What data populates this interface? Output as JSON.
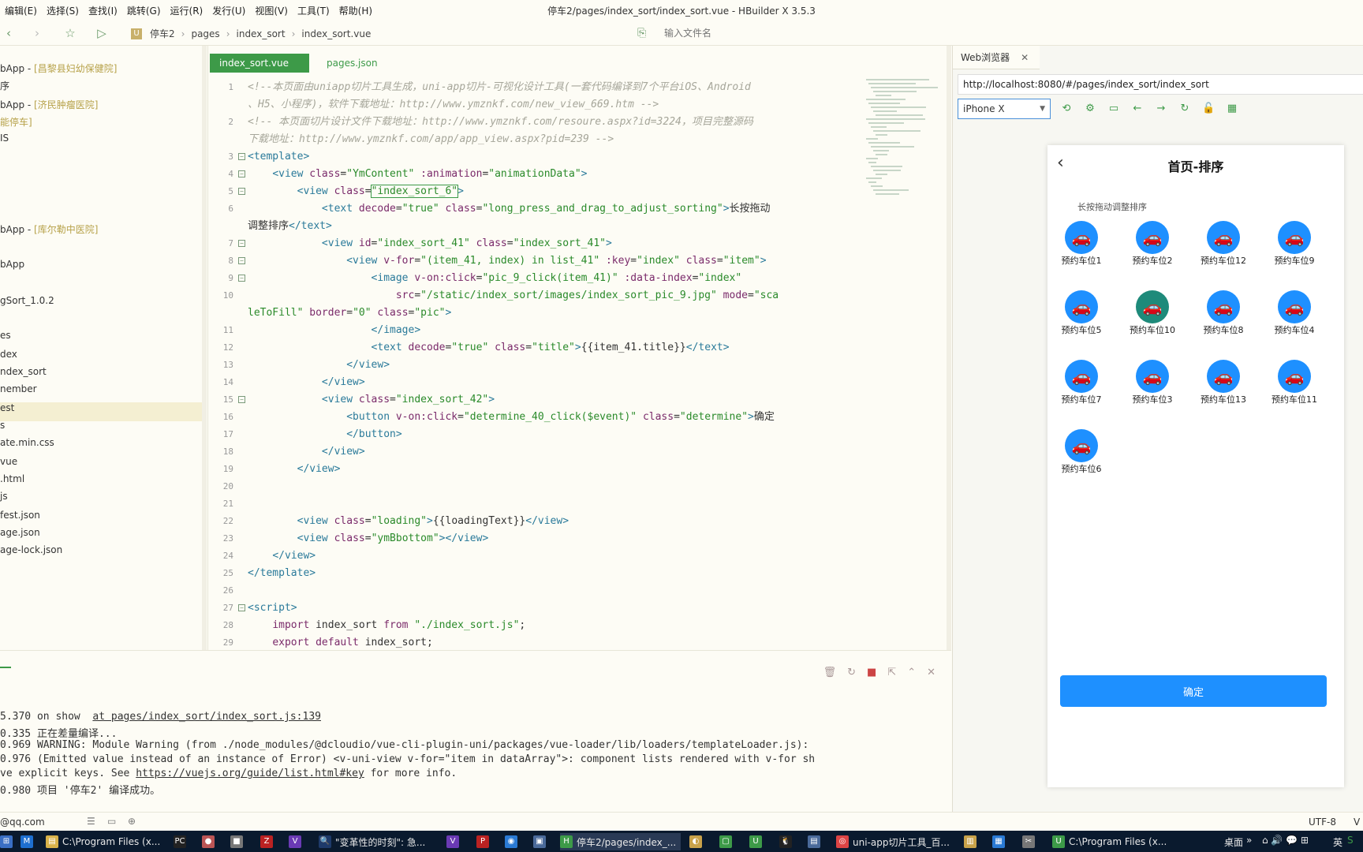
{
  "menu": [
    "编辑(E)",
    "选择(S)",
    "查找(I)",
    "跳转(G)",
    "运行(R)",
    "发行(U)",
    "视图(V)",
    "工具(T)",
    "帮助(H)"
  ],
  "window_title": "停车2/pages/index_sort/index_sort.vue - HBuilder X 3.5.3",
  "breadcrumb": [
    "停车2",
    "pages",
    "index_sort",
    "index_sort.vue"
  ],
  "file_search_placeholder": "输入文件名",
  "sidebar": {
    "items": [
      {
        "pre": "bApp - ",
        "hl": "[昌黎县妇幼保健院]"
      },
      {
        "pre": "序",
        "hl": ""
      },
      {
        "pre": "bApp - ",
        "hl": "[济民肿瘤医院]"
      },
      {
        "pre": "",
        "hl": "能停车]"
      },
      {
        "pre": "IS",
        "hl": ""
      },
      {
        "pre": "bApp - ",
        "hl": "[库尔勒中医院]"
      },
      {
        "pre": "bApp",
        "hl": ""
      },
      {
        "pre": "gSort_1.0.2",
        "hl": ""
      },
      {
        "pre": "es",
        "hl": ""
      },
      {
        "pre": "dex",
        "hl": ""
      },
      {
        "pre": "ndex_sort",
        "hl": ""
      },
      {
        "pre": "nember",
        "hl": ""
      },
      {
        "pre": "est",
        "hl": ""
      },
      {
        "pre": "s",
        "hl": ""
      },
      {
        "pre": "ate.min.css",
        "hl": ""
      },
      {
        "pre": "vue",
        "hl": ""
      },
      {
        "pre": ".html",
        "hl": ""
      },
      {
        "pre": "js",
        "hl": ""
      },
      {
        "pre": "fest.json",
        "hl": ""
      },
      {
        "pre": "age.json",
        "hl": ""
      },
      {
        "pre": "age-lock.json",
        "hl": ""
      }
    ]
  },
  "editor": {
    "tabs": [
      "index_sort.vue",
      "pages.json"
    ],
    "lines": [
      {
        "n": "1",
        "fold": false,
        "parts": [
          [
            "cm",
            "<!--本页面由uniapp切片工具生成，uni-app切片-可视化设计工具(一套代码编译到7个平台iOS、Android"
          ]
        ]
      },
      {
        "n": "",
        "fold": false,
        "parts": [
          [
            "cm",
            "、H5、小程序)，软件下载地址：http://www.ymznkf.com/new_view_669.htm -->"
          ]
        ]
      },
      {
        "n": "2",
        "fold": false,
        "parts": [
          [
            "cm",
            "<!-- 本页面切片设计文件下载地址：http://www.ymznkf.com/resoure.aspx?id=3224，项目完整源码"
          ]
        ]
      },
      {
        "n": "",
        "fold": false,
        "parts": [
          [
            "cm",
            "下载地址：http://www.ymznkf.com/app/app_view.aspx?pid=239 -->"
          ]
        ]
      },
      {
        "n": "3",
        "fold": true,
        "parts": [
          [
            "tg",
            "<template>"
          ]
        ]
      },
      {
        "n": "4",
        "fold": true,
        "parts": [
          [
            "tx",
            "    "
          ],
          [
            "tg",
            "<view "
          ],
          [
            "at",
            "class"
          ],
          [
            "tx",
            "="
          ],
          [
            "st",
            "\"YmContent\""
          ],
          [
            "at",
            " :animation"
          ],
          [
            "tx",
            "="
          ],
          [
            "st",
            "\"animationData\""
          ],
          [
            "tg",
            ">"
          ]
        ]
      },
      {
        "n": "5",
        "fold": true,
        "parts": [
          [
            "tx",
            "        "
          ],
          [
            "tg",
            "<view "
          ],
          [
            "at",
            "class"
          ],
          [
            "tx",
            "="
          ],
          [
            "st",
            "\"index_sort_6\""
          ],
          [
            "tg",
            ">"
          ]
        ]
      },
      {
        "n": "6",
        "fold": false,
        "parts": [
          [
            "tx",
            "            "
          ],
          [
            "tg",
            "<text "
          ],
          [
            "at",
            "decode"
          ],
          [
            "tx",
            "="
          ],
          [
            "st",
            "\"true\""
          ],
          [
            "at",
            " class"
          ],
          [
            "tx",
            "="
          ],
          [
            "st",
            "\"long_press_and_drag_to_adjust_sorting\""
          ],
          [
            "tg",
            ">"
          ],
          [
            "tx",
            "长按拖动"
          ]
        ]
      },
      {
        "n": "",
        "fold": false,
        "parts": [
          [
            "tx",
            "调整排序"
          ],
          [
            "tg",
            "</text>"
          ]
        ]
      },
      {
        "n": "7",
        "fold": true,
        "parts": [
          [
            "tx",
            "            "
          ],
          [
            "tg",
            "<view "
          ],
          [
            "at",
            "id"
          ],
          [
            "tx",
            "="
          ],
          [
            "st",
            "\"index_sort_41\""
          ],
          [
            "at",
            " class"
          ],
          [
            "tx",
            "="
          ],
          [
            "st",
            "\"index_sort_41\""
          ],
          [
            "tg",
            ">"
          ]
        ]
      },
      {
        "n": "8",
        "fold": true,
        "parts": [
          [
            "tx",
            "                "
          ],
          [
            "tg",
            "<view "
          ],
          [
            "at",
            "v-for"
          ],
          [
            "tx",
            "="
          ],
          [
            "st",
            "\"(item_41, index) in list_41\""
          ],
          [
            "at",
            " :key"
          ],
          [
            "tx",
            "="
          ],
          [
            "st",
            "\"index\""
          ],
          [
            "at",
            " class"
          ],
          [
            "tx",
            "="
          ],
          [
            "st",
            "\"item\""
          ],
          [
            "tg",
            ">"
          ]
        ]
      },
      {
        "n": "9",
        "fold": true,
        "parts": [
          [
            "tx",
            "                    "
          ],
          [
            "tg",
            "<image "
          ],
          [
            "at",
            "v-on:click"
          ],
          [
            "tx",
            "="
          ],
          [
            "st",
            "\"pic_9_click(item_41)\""
          ],
          [
            "at",
            " :data-index"
          ],
          [
            "tx",
            "="
          ],
          [
            "st",
            "\"index\""
          ]
        ]
      },
      {
        "n": "10",
        "fold": false,
        "parts": [
          [
            "tx",
            "                        "
          ],
          [
            "at",
            "src"
          ],
          [
            "tx",
            "="
          ],
          [
            "st",
            "\"/static/index_sort/images/index_sort_pic_9.jpg\""
          ],
          [
            "at",
            " mode"
          ],
          [
            "tx",
            "="
          ],
          [
            "st",
            "\"sca"
          ]
        ]
      },
      {
        "n": "",
        "fold": false,
        "parts": [
          [
            "st",
            "leToFill\""
          ],
          [
            "at",
            " border"
          ],
          [
            "tx",
            "="
          ],
          [
            "st",
            "\"0\""
          ],
          [
            "at",
            " class"
          ],
          [
            "tx",
            "="
          ],
          [
            "st",
            "\"pic\""
          ],
          [
            "tg",
            ">"
          ]
        ]
      },
      {
        "n": "11",
        "fold": false,
        "parts": [
          [
            "tx",
            "                    "
          ],
          [
            "tg",
            "</image>"
          ]
        ]
      },
      {
        "n": "12",
        "fold": false,
        "parts": [
          [
            "tx",
            "                    "
          ],
          [
            "tg",
            "<text "
          ],
          [
            "at",
            "decode"
          ],
          [
            "tx",
            "="
          ],
          [
            "st",
            "\"true\""
          ],
          [
            "at",
            " class"
          ],
          [
            "tx",
            "="
          ],
          [
            "st",
            "\"title\""
          ],
          [
            "tg",
            ">"
          ],
          [
            "tx",
            "{{item_41.title}}"
          ],
          [
            "tg",
            "</text>"
          ]
        ]
      },
      {
        "n": "13",
        "fold": false,
        "parts": [
          [
            "tx",
            "                "
          ],
          [
            "tg",
            "</view>"
          ]
        ]
      },
      {
        "n": "14",
        "fold": false,
        "parts": [
          [
            "tx",
            "            "
          ],
          [
            "tg",
            "</view>"
          ]
        ]
      },
      {
        "n": "15",
        "fold": true,
        "parts": [
          [
            "tx",
            "            "
          ],
          [
            "tg",
            "<view "
          ],
          [
            "at",
            "class"
          ],
          [
            "tx",
            "="
          ],
          [
            "st",
            "\"index_sort_42\""
          ],
          [
            "tg",
            ">"
          ]
        ]
      },
      {
        "n": "16",
        "fold": false,
        "parts": [
          [
            "tx",
            "                "
          ],
          [
            "tg",
            "<button "
          ],
          [
            "at",
            "v-on:click"
          ],
          [
            "tx",
            "="
          ],
          [
            "st",
            "\"determine_40_click($event)\""
          ],
          [
            "at",
            " class"
          ],
          [
            "tx",
            "="
          ],
          [
            "st",
            "\"determine\""
          ],
          [
            "tg",
            ">"
          ],
          [
            "tx",
            "确定"
          ]
        ]
      },
      {
        "n": "17",
        "fold": false,
        "parts": [
          [
            "tx",
            "                "
          ],
          [
            "tg",
            "</button>"
          ]
        ]
      },
      {
        "n": "18",
        "fold": false,
        "parts": [
          [
            "tx",
            "            "
          ],
          [
            "tg",
            "</view>"
          ]
        ]
      },
      {
        "n": "19",
        "fold": false,
        "parts": [
          [
            "tx",
            "        "
          ],
          [
            "tg",
            "</view>"
          ]
        ]
      },
      {
        "n": "20",
        "fold": false,
        "parts": []
      },
      {
        "n": "21",
        "fold": false,
        "parts": []
      },
      {
        "n": "22",
        "fold": false,
        "parts": [
          [
            "tx",
            "        "
          ],
          [
            "tg",
            "<view "
          ],
          [
            "at",
            "class"
          ],
          [
            "tx",
            "="
          ],
          [
            "st",
            "\"loading\""
          ],
          [
            "tg",
            ">"
          ],
          [
            "tx",
            "{{loadingText}}"
          ],
          [
            "tg",
            "</view>"
          ]
        ]
      },
      {
        "n": "23",
        "fold": false,
        "parts": [
          [
            "tx",
            "        "
          ],
          [
            "tg",
            "<view "
          ],
          [
            "at",
            "class"
          ],
          [
            "tx",
            "="
          ],
          [
            "st",
            "\"ymBbottom\""
          ],
          [
            "tg",
            "></view>"
          ]
        ]
      },
      {
        "n": "24",
        "fold": false,
        "parts": [
          [
            "tx",
            "    "
          ],
          [
            "tg",
            "</view>"
          ]
        ]
      },
      {
        "n": "25",
        "fold": false,
        "parts": [
          [
            "tg",
            "</template>"
          ]
        ]
      },
      {
        "n": "26",
        "fold": false,
        "parts": []
      },
      {
        "n": "27",
        "fold": true,
        "parts": [
          [
            "tg",
            "<script>"
          ]
        ]
      },
      {
        "n": "28",
        "fold": false,
        "parts": [
          [
            "tx",
            "    "
          ],
          [
            "kw",
            "import"
          ],
          [
            "tx",
            " index_sort "
          ],
          [
            "kw",
            "from"
          ],
          [
            "st",
            " \"./index_sort.js\""
          ],
          [
            "tx",
            ";"
          ]
        ]
      },
      {
        "n": "29",
        "fold": false,
        "parts": [
          [
            "tx",
            "    "
          ],
          [
            "kw",
            "export default"
          ],
          [
            "tx",
            " index_sort;"
          ]
        ]
      }
    ]
  },
  "console": {
    "lines": [
      {
        "pre": "5.370 on show  ",
        "link": "at pages/index_sort/index_sort.js:139",
        "post": ""
      },
      {
        "pre": "0.335 正在差量编译...",
        "link": "",
        "post": ""
      },
      {
        "pre": "0.969 WARNING: Module Warning (from ./node_modules/@dcloudio/vue-cli-plugin-uni/packages/vue-loader/lib/loaders/templateLoader.js):",
        "link": "",
        "post": ""
      },
      {
        "pre": "0.976 (Emitted value instead of an instance of Error) <v-uni-view v-for=\"item in dataArray\">: component lists rendered with v-for sh",
        "link": "",
        "post": ""
      },
      {
        "pre": "ve explicit keys. See ",
        "link": "https://vuejs.org/guide/list.html#key",
        "post": " for more info."
      },
      {
        "pre": "0.980 项目 '停车2' 编译成功。",
        "link": "",
        "post": ""
      }
    ]
  },
  "statusbar": {
    "email": "@qq.com",
    "encoding": "UTF-8",
    "extra": "V"
  },
  "browser": {
    "tab_label": "Web浏览器",
    "url": "http://localhost:8080/#/pages/index_sort/index_sort",
    "device": "iPhone X"
  },
  "phone": {
    "title": "首页-排序",
    "hint": "长按拖动调整排序",
    "slots": [
      "预约车位1",
      "预约车位2",
      "预约车位12",
      "预约车位9",
      "预约车位5",
      "预约车位10",
      "预约车位8",
      "预约车位4",
      "预约车位7",
      "预约车位3",
      "预约车位13",
      "预约车位11",
      "预约车位6"
    ],
    "dragging_index": 5,
    "confirm_label": "确定"
  },
  "taskbar": {
    "items": [
      "C:\\Program Files (x...",
      "\"变革性的时刻\": 急...",
      "停车2/pages/index_...",
      "uni-app切片工具_百...",
      "C:\\Program Files (x..."
    ],
    "right": [
      "桌面",
      "英"
    ]
  }
}
